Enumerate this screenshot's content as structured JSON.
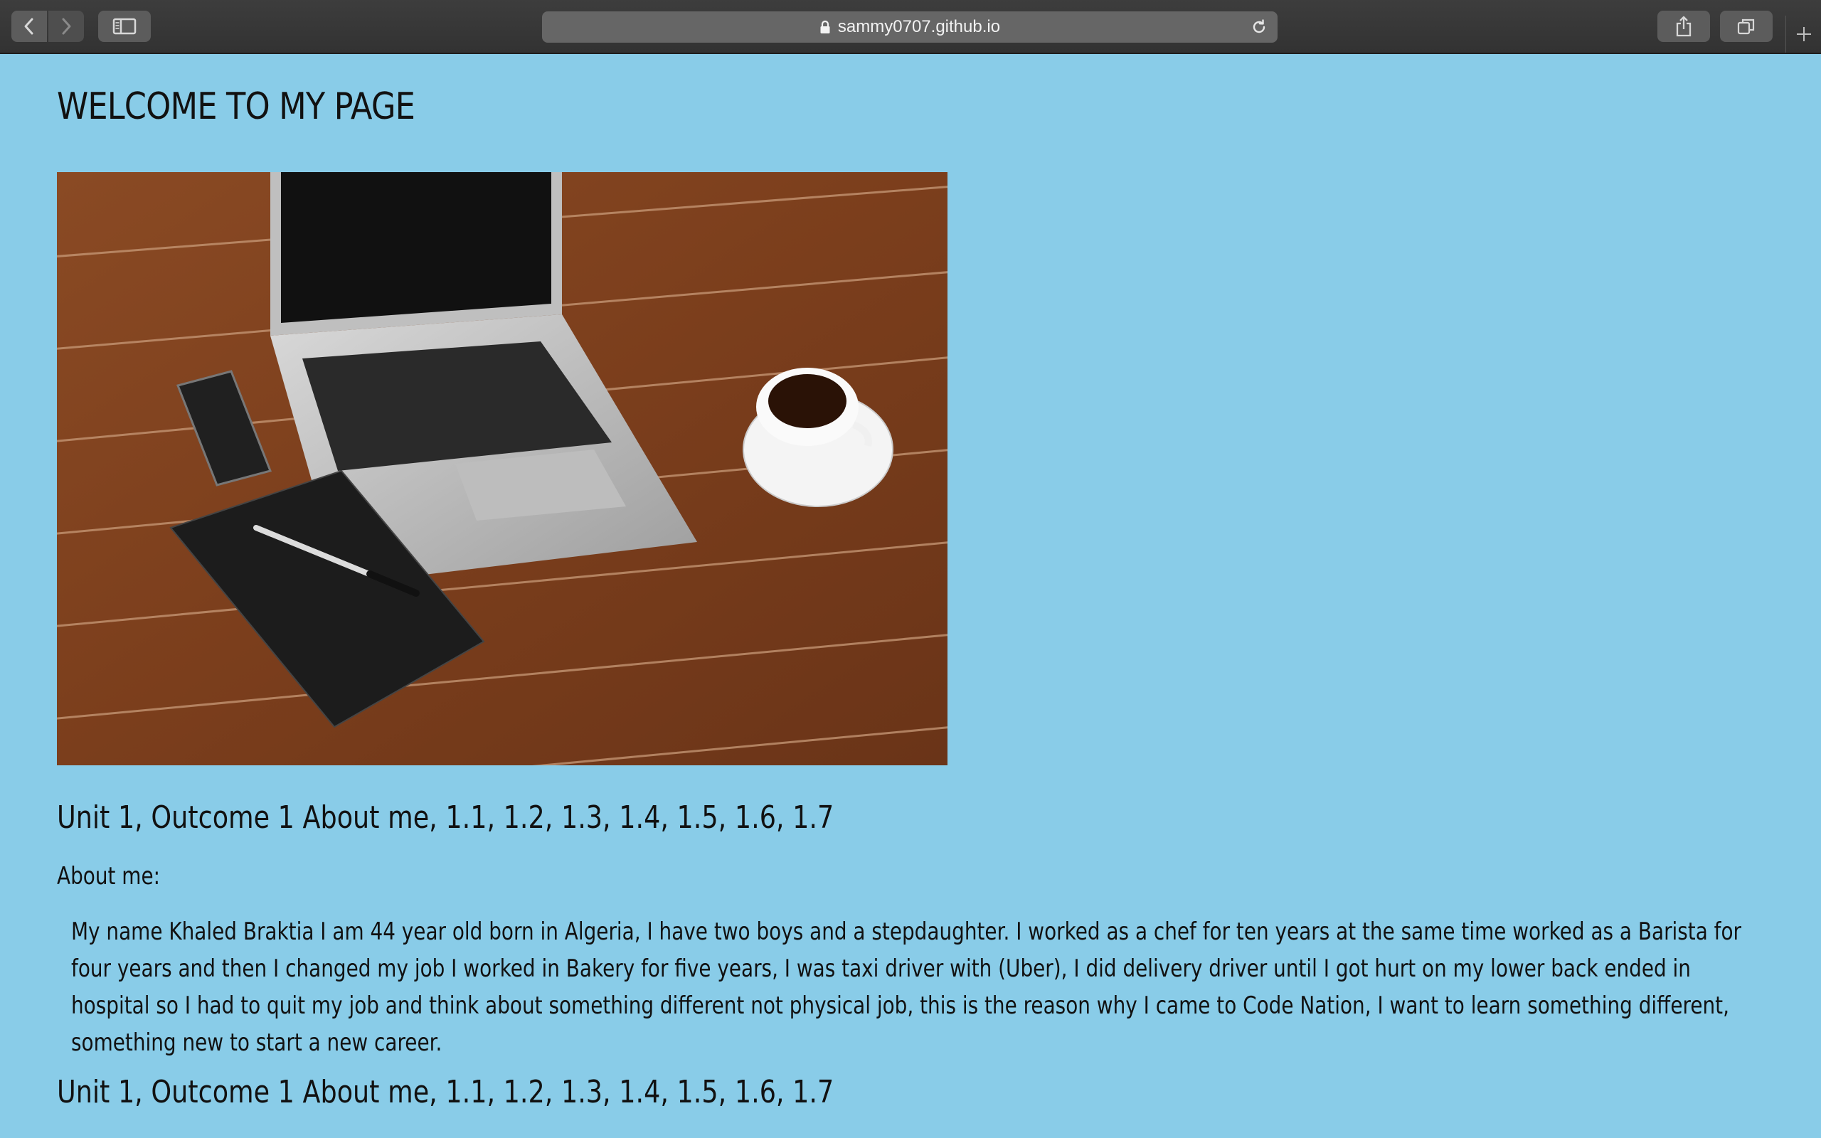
{
  "browser": {
    "url": "sammy0707.github.io",
    "icons": {
      "back": "chevron-left-icon",
      "forward": "chevron-right-icon",
      "sidebar": "sidebar-icon",
      "lock": "lock-icon",
      "reload": "reload-icon",
      "share": "share-icon",
      "tabs": "tabs-icon",
      "new_tab": "plus-icon"
    },
    "forward_enabled": false
  },
  "page": {
    "title": "WELCOME TO MY PAGE",
    "hero_image": "laptop-desk-photo",
    "background_color": "#89cce8",
    "sections": [
      {
        "heading": "Unit 1, Outcome 1 About me, 1.1, 1.2, 1.3, 1.4, 1.5, 1.6, 1.7",
        "label": "About me:",
        "text": "My name Khaled Braktia I am 44 year old born in Algeria, I have two boys and a stepdaughter. I worked as a chef for ten years at the same time worked as a Barista for four years and then I changed my job I worked in Bakery for five years, I was taxi driver with (Uber), I did delivery driver until I got hurt on my lower back ended in hospital so I had to quit my job and think about something different not physical job, this is the reason why I came to Code Nation, I want to learn something different, something new to start a new career."
      },
      {
        "heading": "Unit 1, Outcome 1 About me, 1.1, 1.2, 1.3, 1.4, 1.5, 1.6, 1.7"
      }
    ]
  }
}
